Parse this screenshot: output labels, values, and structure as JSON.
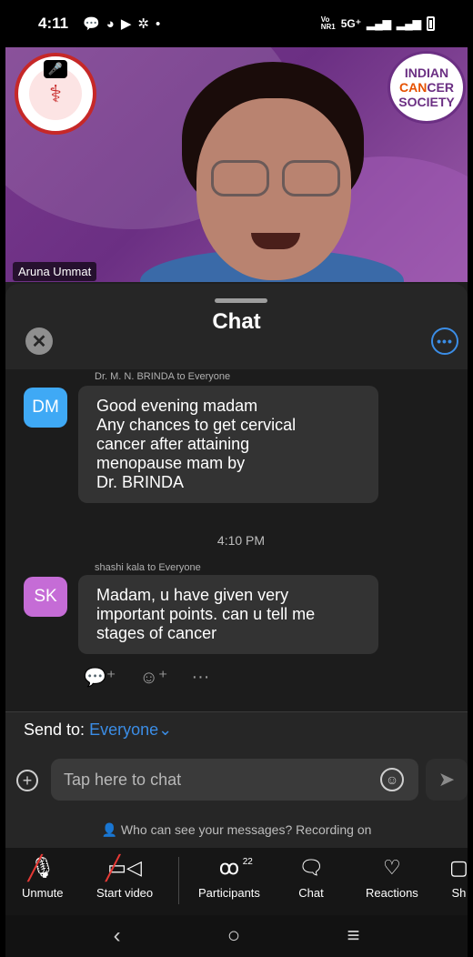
{
  "status_bar": {
    "time": "4:11",
    "network": "5G⁺",
    "carrier_tag": "Vo NR1"
  },
  "video": {
    "speaker_name": "Aruna Ummat",
    "logo_right_lines": [
      "INDIAN",
      "CAN",
      "CER",
      "SOCIETY"
    ],
    "left_logo_icon": "org-seal-icon",
    "mute_icon": "mic-off-icon"
  },
  "chat": {
    "title": "Chat",
    "messages": [
      {
        "sender": "Dr. M. N. BRINDA to Everyone",
        "initials": "DM",
        "avatar_color": "#3fa9f5",
        "lines": [
          "Good evening madam",
          "Any chances to get cervical",
          "cancer after attaining",
          "menopause mam by",
          "Dr. BRINDA"
        ]
      },
      {
        "sender": "shashi kala to Everyone",
        "initials": "SK",
        "avatar_color": "#c56cd6",
        "lines": [
          "Madam, u have given very",
          "important points. can u tell me",
          "stages of cancer"
        ]
      }
    ],
    "timestamp": "4:10 PM",
    "send_to_label": "Send to:",
    "send_to_value": "Everyone",
    "input_placeholder": "Tap here to chat",
    "privacy_text": "Who can see your messages? Recording on"
  },
  "toolbar": {
    "items": [
      {
        "label": "Unmute",
        "icon": "mic-off-icon"
      },
      {
        "label": "Start video",
        "icon": "video-off-icon"
      },
      {
        "label": "Participants",
        "icon": "participants-icon",
        "count": "22"
      },
      {
        "label": "Chat",
        "icon": "chat-icon"
      },
      {
        "label": "Reactions",
        "icon": "heart-icon"
      },
      {
        "label": "Sh",
        "icon": "share-icon"
      }
    ]
  },
  "colors": {
    "accent": "#3b8de6",
    "panel": "#262626",
    "bubble": "#333333",
    "muted_red": "#e53935"
  }
}
